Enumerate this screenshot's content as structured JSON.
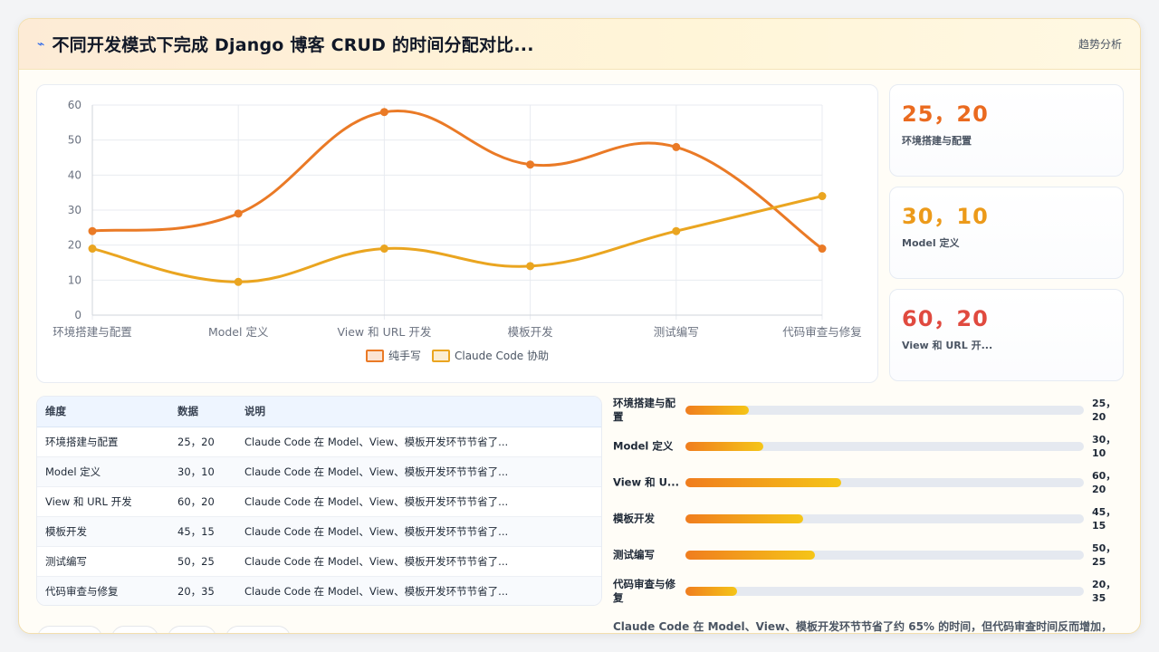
{
  "header": {
    "logo_icon": "trend-icon",
    "title": "不同开发模式下完成 Django 博客 CRUD 的时间分配对比...",
    "action": "趋势分析"
  },
  "chart_data": {
    "type": "line",
    "categories": [
      "环境搭建与配置",
      "Model 定义",
      "View 和 URL 开发",
      "模板开发",
      "测试编写",
      "代码审查与修复"
    ],
    "series": [
      {
        "name": "纯手写",
        "color": "#ea7a26",
        "values": [
          24,
          29,
          58,
          43,
          48,
          19
        ]
      },
      {
        "name": "Claude Code 协助",
        "color": "#eaa520",
        "values": [
          19,
          9.5,
          19,
          14,
          24,
          34
        ]
      }
    ],
    "yticks": [
      "0",
      "10",
      "20",
      "30",
      "40",
      "50",
      "60"
    ],
    "ylim": [
      0,
      60
    ],
    "grid": true,
    "legend": "bottom"
  },
  "stats": [
    {
      "value": "25，20",
      "label": "环境搭建与配置",
      "color": "#ea6a1f"
    },
    {
      "value": "30，10",
      "label": "Model 定义",
      "color": "#ec9a1a"
    },
    {
      "value": "60，20",
      "label": "View 和 URL 开...",
      "color": "#e04a3f"
    }
  ],
  "table": {
    "headers": [
      "维度",
      "数据",
      "说明"
    ],
    "rows": [
      [
        "环境搭建与配置",
        "25，20",
        "Claude Code 在 Model、View、模板开发环节节省了..."
      ],
      [
        "Model 定义",
        "30，10",
        "Claude Code 在 Model、View、模板开发环节节省了..."
      ],
      [
        "View 和 URL 开发",
        "60，20",
        "Claude Code 在 Model、View、模板开发环节节省了..."
      ],
      [
        "模板开发",
        "45，15",
        "Claude Code 在 Model、View、模板开发环节节省了..."
      ],
      [
        "测试编写",
        "50，25",
        "Claude Code 在 Model、View、模板开发环节节省了..."
      ],
      [
        "代码审查与修复",
        "20，35",
        "Claude Code 在 Model、View、模板开发环节节省了..."
      ]
    ]
  },
  "bars": [
    {
      "label": "环境搭建与配置",
      "value": "25，20",
      "fill": 0.16
    },
    {
      "label": "Model 定义",
      "value": "30，10",
      "fill": 0.195
    },
    {
      "label": "View 和 U...",
      "value": "60，20",
      "fill": 0.39
    },
    {
      "label": "模板开发",
      "value": "45，15",
      "fill": 0.295
    },
    {
      "label": "测试编写",
      "value": "50，25",
      "fill": 0.325
    },
    {
      "label": "代码审查与修复",
      "value": "20，35",
      "fill": 0.13
    }
  ],
  "summary": "Claude Code 在 Model、View、模板开发环节节省了约 65% 的时间，但代码审查时间反而增加，"
}
